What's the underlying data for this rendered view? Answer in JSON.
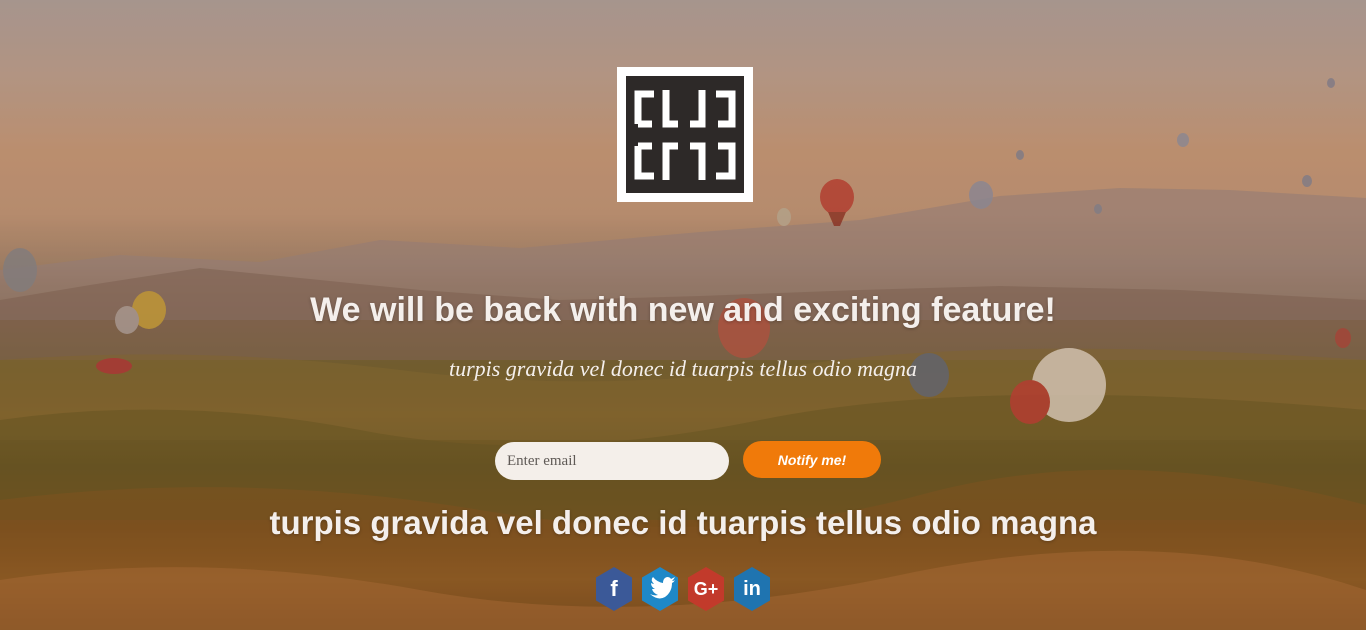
{
  "page": {
    "headline": "We will be back with new and exciting feature!",
    "subheadline": "turpis gravida vel donec id tuarpis tellus odio magna",
    "tagline": "turpis gravida vel donec id tuarpis tellus odio magna"
  },
  "form": {
    "email_placeholder": "Enter email",
    "email_value": "",
    "notify_label": "Notify me!"
  },
  "social": [
    {
      "name": "facebook",
      "glyph": "f",
      "color": "#3b5998"
    },
    {
      "name": "twitter",
      "glyph": "t",
      "color": "#1da1f2"
    },
    {
      "name": "google-plus",
      "glyph": "G+",
      "color": "#dd4b39"
    },
    {
      "name": "linkedin",
      "glyph": "in",
      "color": "#1f74b0"
    }
  ],
  "colors": {
    "accent": "#f07a0a",
    "logo_dark": "#2d2928",
    "text": "#f4efec"
  }
}
